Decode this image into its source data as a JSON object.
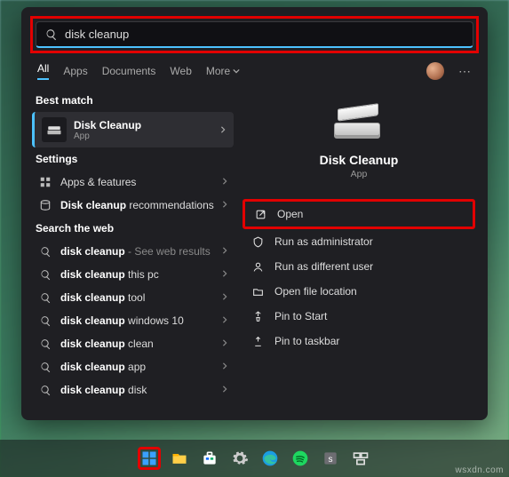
{
  "search": {
    "value": "disk cleanup"
  },
  "tabs": {
    "all": "All",
    "apps": "Apps",
    "documents": "Documents",
    "web": "Web",
    "more": "More"
  },
  "sections": {
    "best": "Best match",
    "settings": "Settings",
    "web": "Search the web"
  },
  "best_match": {
    "title": "Disk Cleanup",
    "subtitle": "App"
  },
  "settings_items": [
    {
      "label": "Apps & features"
    },
    {
      "label_prefix": "",
      "label_bold": "Disk cleanup",
      "label_suffix": " recommendations"
    }
  ],
  "web_items": [
    {
      "bold": "disk cleanup",
      "suffix": "",
      "hint": " - See web results"
    },
    {
      "bold": "disk cleanup",
      "suffix": " this pc",
      "hint": ""
    },
    {
      "bold": "disk cleanup",
      "suffix": " tool",
      "hint": ""
    },
    {
      "bold": "disk cleanup",
      "suffix": " windows 10",
      "hint": ""
    },
    {
      "bold": "disk cleanup",
      "suffix": " clean",
      "hint": ""
    },
    {
      "bold": "disk cleanup",
      "suffix": " app",
      "hint": ""
    },
    {
      "bold": "disk cleanup",
      "suffix": " disk",
      "hint": ""
    }
  ],
  "preview": {
    "title": "Disk Cleanup",
    "subtitle": "App"
  },
  "actions": [
    {
      "id": "open",
      "label": "Open",
      "highlight": true
    },
    {
      "id": "run-admin",
      "label": "Run as administrator"
    },
    {
      "id": "run-diffuser",
      "label": "Run as different user"
    },
    {
      "id": "open-loc",
      "label": "Open file location"
    },
    {
      "id": "pin-start",
      "label": "Pin to Start"
    },
    {
      "id": "pin-taskbar",
      "label": "Pin to taskbar"
    }
  ],
  "taskbar": {
    "icons": [
      "start",
      "explorer",
      "store",
      "settings",
      "edge",
      "spotify",
      "slack",
      "task-view"
    ]
  },
  "watermark": "wsxdn.com"
}
